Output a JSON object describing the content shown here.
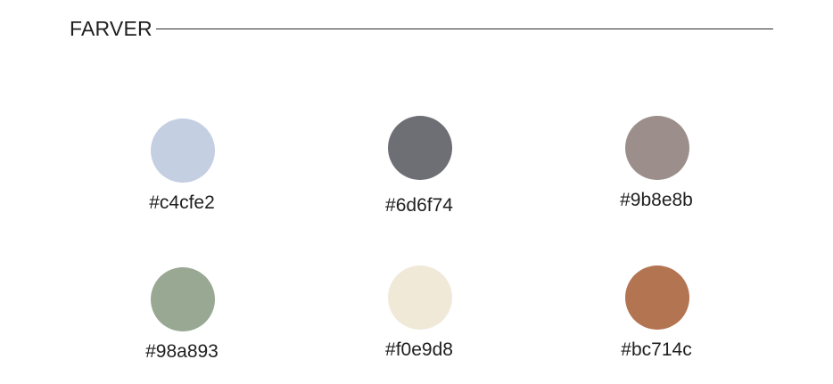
{
  "heading": {
    "title": "FARVER"
  },
  "swatches": [
    {
      "hex_label": "#c4cfe2",
      "color": "#c4cfe2"
    },
    {
      "hex_label": "#6d6f74",
      "color": "#6d6f74"
    },
    {
      "hex_label": "#9b8e8b",
      "color": "#9b8e8b"
    },
    {
      "hex_label": "#98a893",
      "color": "#98a893"
    },
    {
      "hex_label": "#f0e9d8",
      "color": "#f0e9d8"
    },
    {
      "hex_label": "#bc714c",
      "color": "#b37451"
    }
  ]
}
